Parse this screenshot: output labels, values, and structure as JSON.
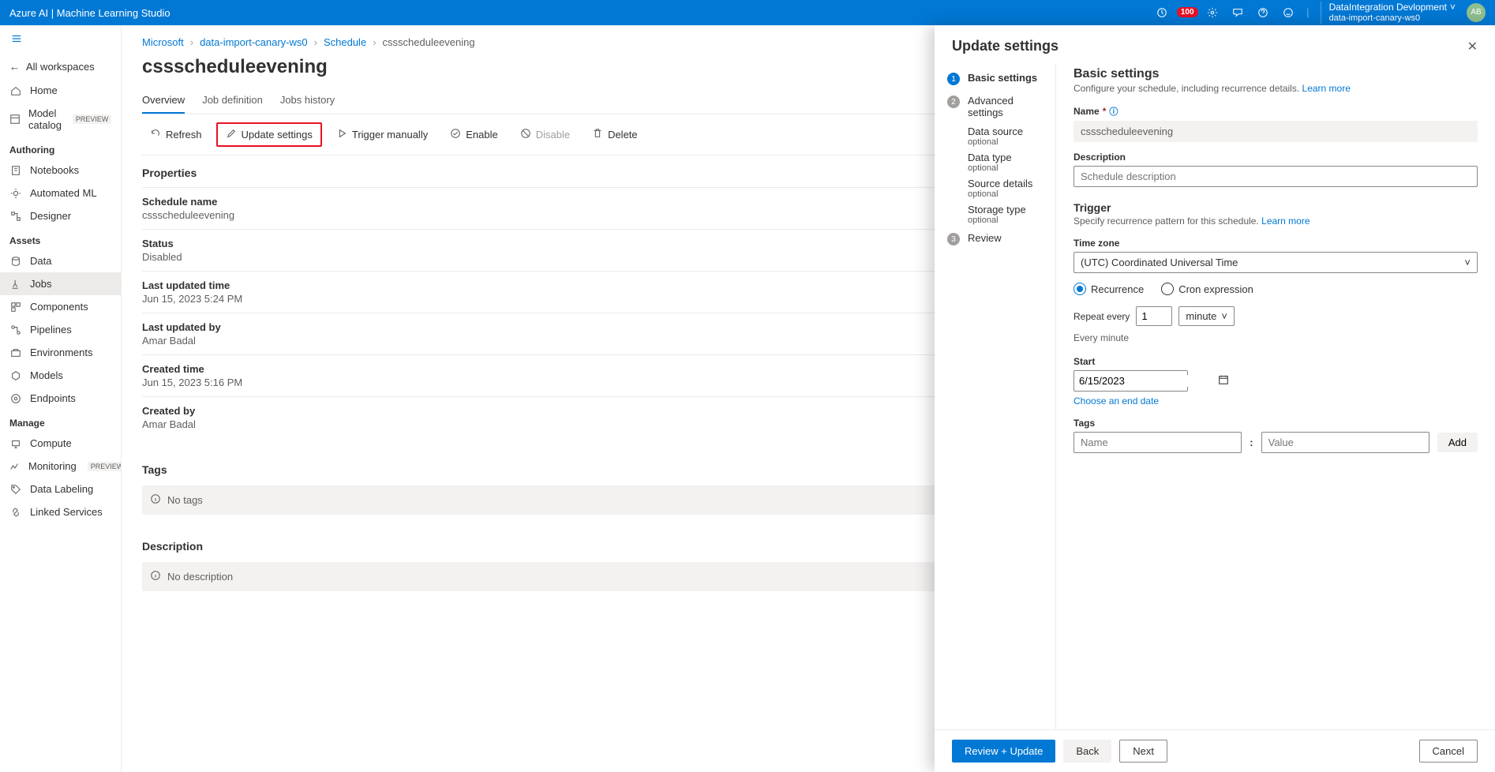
{
  "header": {
    "app_title": "Azure AI | Machine Learning Studio",
    "notif_count": "100",
    "tenant": "DataIntegration Devlopment",
    "workspace": "data-import-canary-ws0",
    "avatar_initials": "AB"
  },
  "sidebar": {
    "back": "All workspaces",
    "home": "Home",
    "model_catalog": "Model catalog",
    "preview": "PREVIEW",
    "authoring": "Authoring",
    "notebooks": "Notebooks",
    "automl": "Automated ML",
    "designer": "Designer",
    "assets": "Assets",
    "data": "Data",
    "jobs": "Jobs",
    "components": "Components",
    "pipelines": "Pipelines",
    "environments": "Environments",
    "models": "Models",
    "endpoints": "Endpoints",
    "manage": "Manage",
    "compute": "Compute",
    "monitoring": "Monitoring",
    "data_labeling": "Data Labeling",
    "linked_services": "Linked Services"
  },
  "breadcrumb": {
    "root": "Microsoft",
    "ws": "data-import-canary-ws0",
    "schedule": "Schedule",
    "current": "cssscheduleevening"
  },
  "page": {
    "title": "cssscheduleevening",
    "tabs": {
      "overview": "Overview",
      "jobdef": "Job definition",
      "jobshistory": "Jobs history"
    }
  },
  "toolbar": {
    "refresh": "Refresh",
    "update": "Update settings",
    "trigger": "Trigger manually",
    "enable": "Enable",
    "disable": "Disable",
    "delete": "Delete"
  },
  "properties": {
    "heading": "Properties",
    "schedule_name_label": "Schedule name",
    "schedule_name_value": "cssscheduleevening",
    "status_label": "Status",
    "status_value": "Disabled",
    "lastupdated_label": "Last updated time",
    "lastupdated_value": "Jun 15, 2023 5:24 PM",
    "lastupdatedby_label": "Last updated by",
    "lastupdatedby_value": "Amar Badal",
    "created_label": "Created time",
    "created_value": "Jun 15, 2023 5:16 PM",
    "createdby_label": "Created by",
    "createdby_value": "Amar Badal",
    "tags_heading": "Tags",
    "no_tags": "No tags",
    "description_heading": "Description",
    "no_description": "No description"
  },
  "drawer": {
    "title": "Update settings",
    "steps": {
      "basic": "Basic settings",
      "advanced": "Advanced settings",
      "data_source": "Data source",
      "data_type": "Data type",
      "source_details": "Source details",
      "storage_type": "Storage type",
      "optional": "optional",
      "review": "Review"
    },
    "form": {
      "section_title": "Basic settings",
      "section_desc": "Configure your schedule, including recurrence details.",
      "learn_more": "Learn more",
      "name_label": "Name",
      "name_value": "cssscheduleevening",
      "description_label": "Description",
      "description_placeholder": "Schedule description",
      "trigger_label": "Trigger",
      "trigger_desc": "Specify recurrence pattern for this schedule.",
      "timezone_label": "Time zone",
      "timezone_value": "(UTC) Coordinated Universal Time",
      "recurrence": "Recurrence",
      "cron": "Cron expression",
      "repeat_every": "Repeat every",
      "repeat_value": "1",
      "repeat_unit": "minute",
      "every_minute": "Every minute",
      "start_label": "Start",
      "start_value": "6/15/2023",
      "choose_end": "Choose an end date",
      "tags_label": "Tags",
      "tag_name_placeholder": "Name",
      "tag_value_placeholder": "Value",
      "add": "Add"
    },
    "footer": {
      "review_update": "Review + Update",
      "back": "Back",
      "next": "Next",
      "cancel": "Cancel"
    }
  }
}
